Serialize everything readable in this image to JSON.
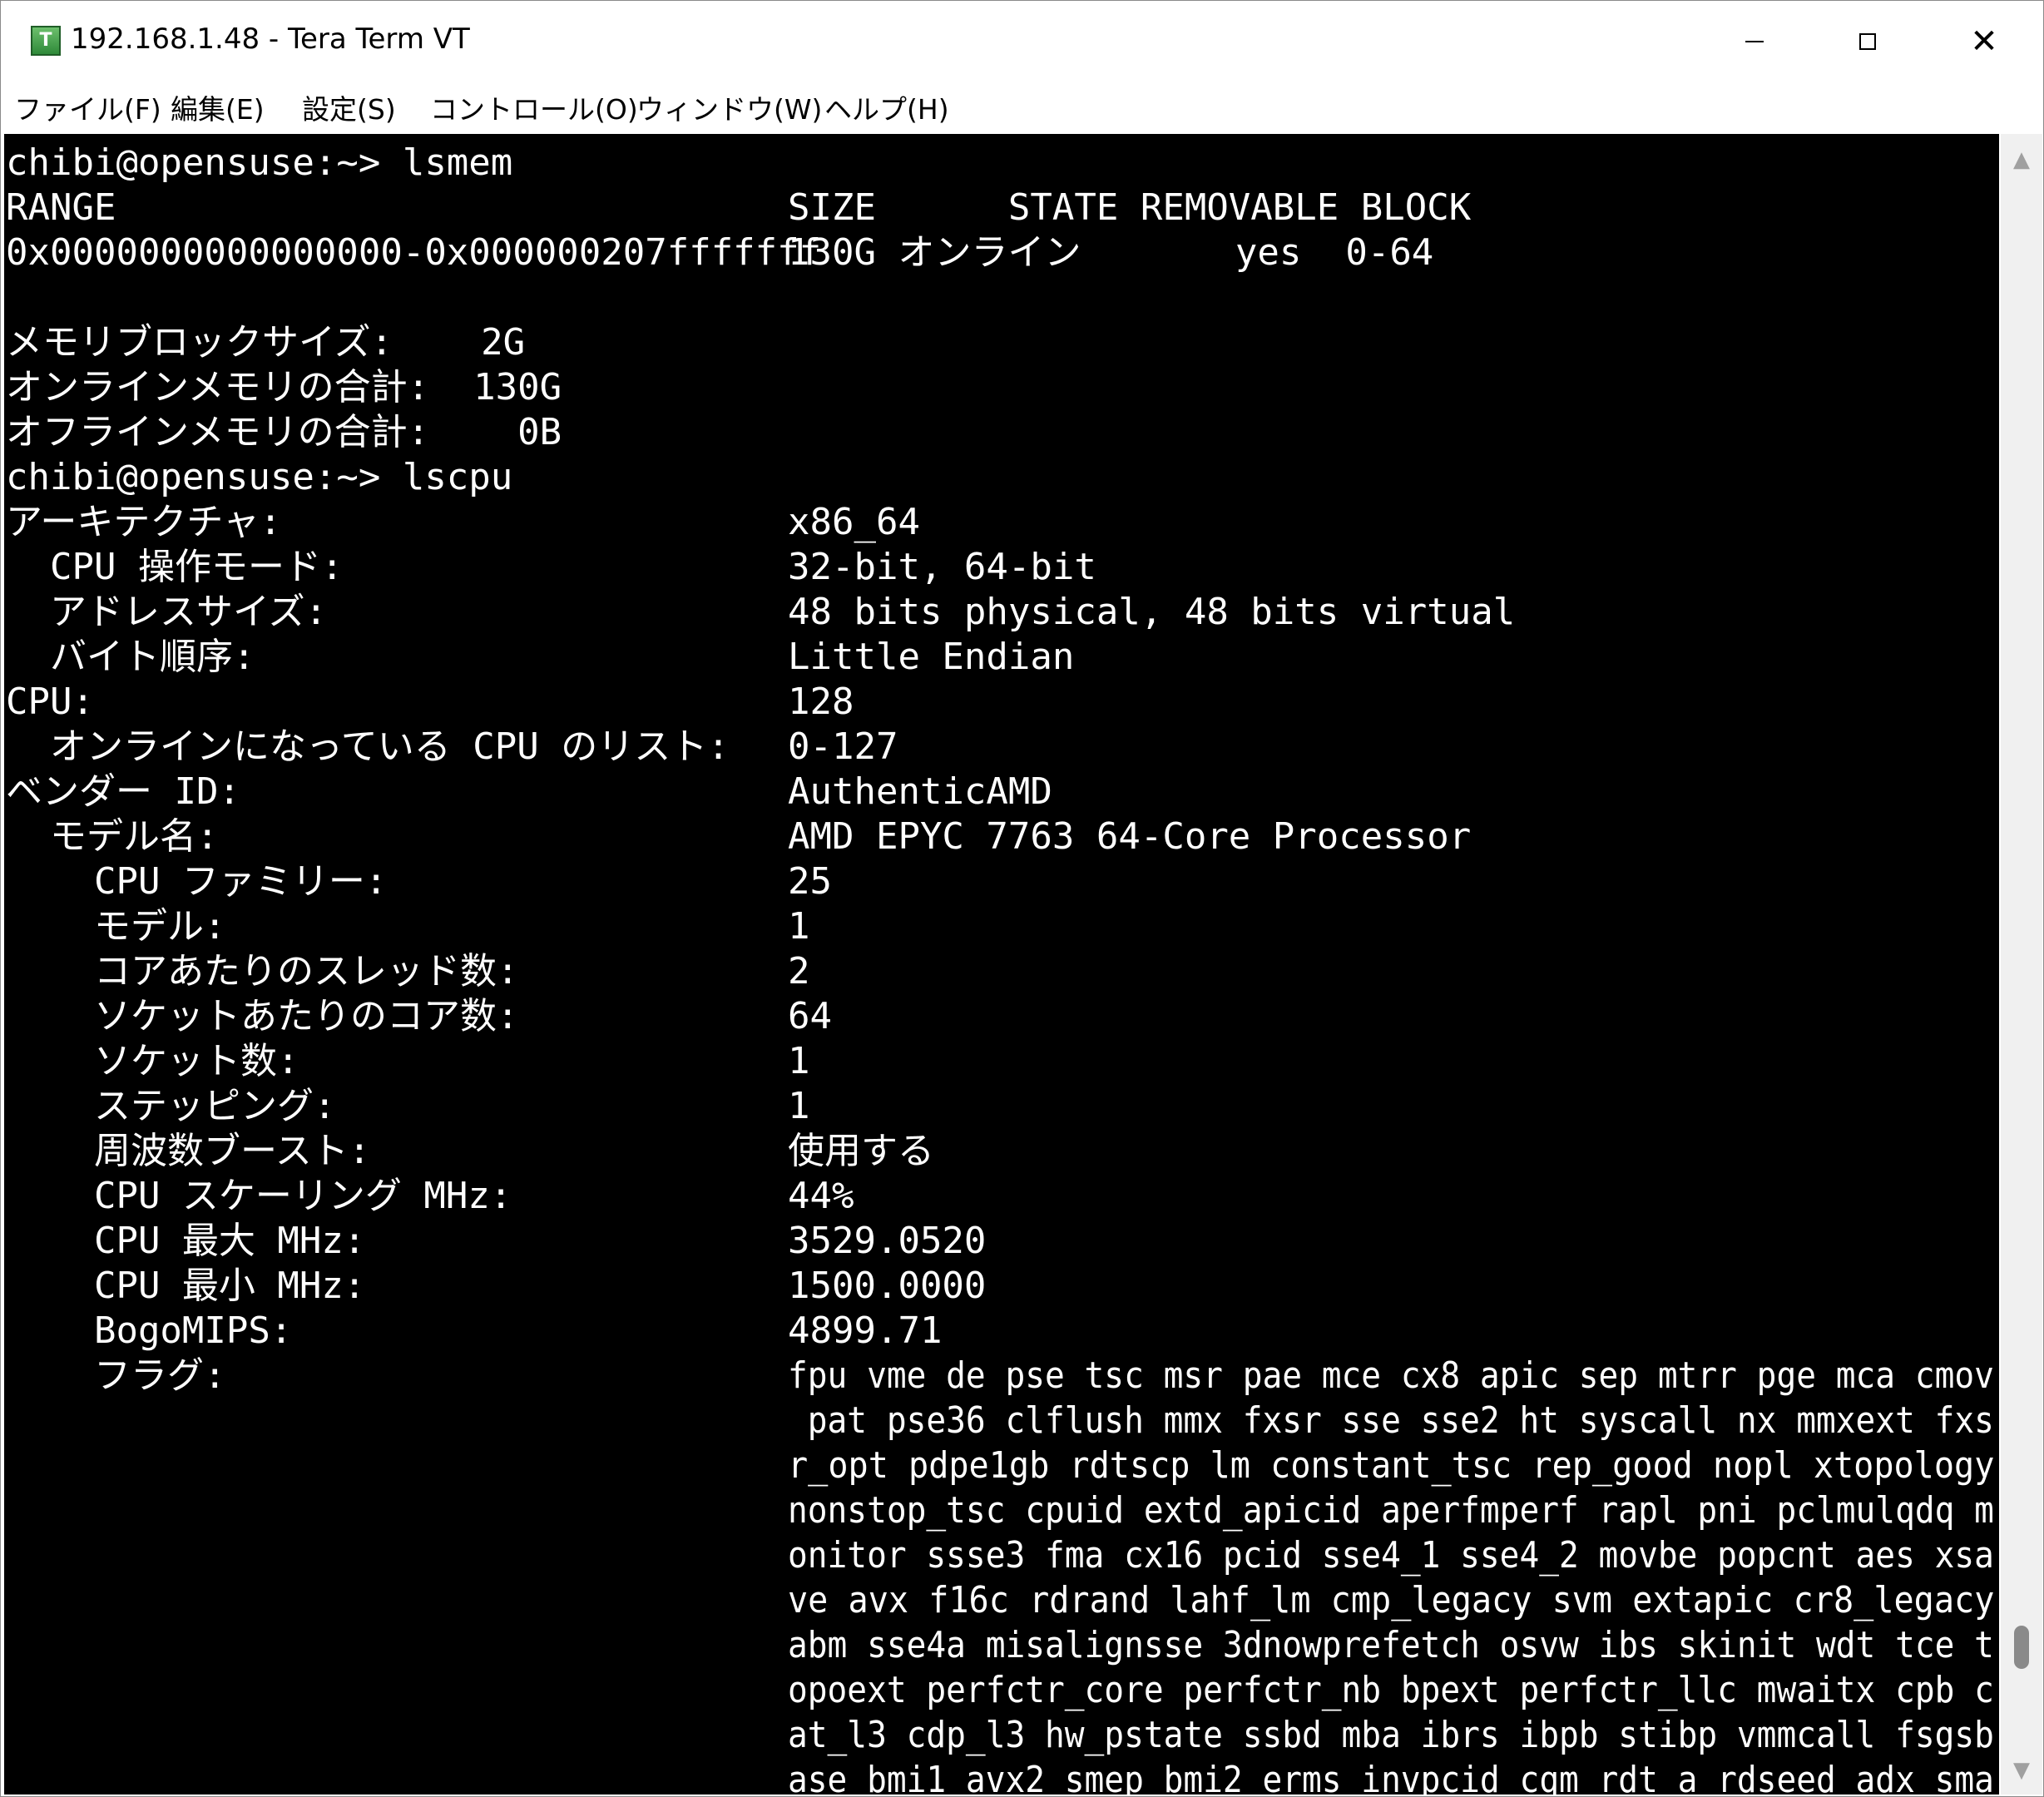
{
  "window": {
    "title": "192.168.1.48 - Tera Term VT",
    "icon": "tera-term-icon",
    "icon_letter": "T",
    "minimize_glyph": "",
    "maximize_glyph": "",
    "close_glyph": "✕"
  },
  "menu": {
    "items": [
      "ファイル(F)",
      "編集(E)",
      "設定(S)",
      "コントロール(O)",
      "ウィンドウ(W)",
      "ヘルプ(H)"
    ]
  },
  "terminal": {
    "lines": [
      {
        "key": "chibi@opensuse:~> lsmem",
        "value": ""
      },
      {
        "key": "RANGE",
        "value": "SIZE      STATE REMOVABLE BLOCK"
      },
      {
        "key": "0x0000000000000000-0x000000207fffffff",
        "value": "130G オンライン       yes  0-64"
      },
      {
        "key": "",
        "value": ""
      },
      {
        "key": "メモリブロックサイズ:    2G",
        "value": ""
      },
      {
        "key": "オンラインメモリの合計:  130G",
        "value": ""
      },
      {
        "key": "オフラインメモリの合計:    0B",
        "value": ""
      },
      {
        "key": "chibi@opensuse:~> lscpu",
        "value": ""
      },
      {
        "key": "アーキテクチャ:",
        "value": "x86_64"
      },
      {
        "key": "  CPU 操作モード:",
        "value": "32-bit, 64-bit"
      },
      {
        "key": "  アドレスサイズ:",
        "value": "48 bits physical, 48 bits virtual"
      },
      {
        "key": "  バイト順序:",
        "value": "Little Endian"
      },
      {
        "key": "CPU:",
        "value": "128"
      },
      {
        "key": "  オンラインになっている CPU のリスト:",
        "value": "0-127"
      },
      {
        "key": "ベンダー ID:",
        "value": "AuthenticAMD"
      },
      {
        "key": "  モデル名:",
        "value": "AMD EPYC 7763 64-Core Processor"
      },
      {
        "key": "    CPU ファミリー:",
        "value": "25"
      },
      {
        "key": "    モデル:",
        "value": "1"
      },
      {
        "key": "    コアあたりのスレッド数:",
        "value": "2"
      },
      {
        "key": "    ソケットあたりのコア数:",
        "value": "64"
      },
      {
        "key": "    ソケット数:",
        "value": "1"
      },
      {
        "key": "    ステッピング:",
        "value": "1"
      },
      {
        "key": "    周波数ブースト:",
        "value": "使用する"
      },
      {
        "key": "    CPU スケーリング MHz:",
        "value": "44%"
      },
      {
        "key": "    CPU 最大 MHz:",
        "value": "3529.0520"
      },
      {
        "key": "    CPU 最小 MHz:",
        "value": "1500.0000"
      },
      {
        "key": "    BogoMIPS:",
        "value": "4899.71"
      },
      {
        "key": "    フラグ:",
        "value": "fpu vme de pse tsc msr pae mce cx8 apic sep mtrr pge mca cmov"
      },
      {
        "key": "",
        "value": " pat pse36 clflush mmx fxsr sse sse2 ht syscall nx mmxext fxs"
      },
      {
        "key": "",
        "value": "r_opt pdpe1gb rdtscp lm constant_tsc rep_good nopl xtopology"
      },
      {
        "key": "",
        "value": "nonstop_tsc cpuid extd_apicid aperfmperf rapl pni pclmulqdq m"
      },
      {
        "key": "",
        "value": "onitor ssse3 fma cx16 pcid sse4_1 sse4_2 movbe popcnt aes xsa"
      },
      {
        "key": "",
        "value": "ve avx f16c rdrand lahf_lm cmp_legacy svm extapic cr8_legacy"
      },
      {
        "key": "",
        "value": "abm sse4a misalignsse 3dnowprefetch osvw ibs skinit wdt tce t"
      },
      {
        "key": "",
        "value": "opoext perfctr_core perfctr_nb bpext perfctr_llc mwaitx cpb c"
      },
      {
        "key": "",
        "value": "at_l3 cdp_l3 hw_pstate ssbd mba ibrs ibpb stibp vmmcall fsgsb"
      },
      {
        "key": "",
        "value": "ase bmi1 avx2 smep bmi2 erms invpcid cqm rdt_a rdseed adx sma"
      }
    ]
  },
  "scrollbar": {
    "up_arrow_icon": "▲",
    "down_arrow_icon": "▼",
    "position_fraction": 0.95
  }
}
